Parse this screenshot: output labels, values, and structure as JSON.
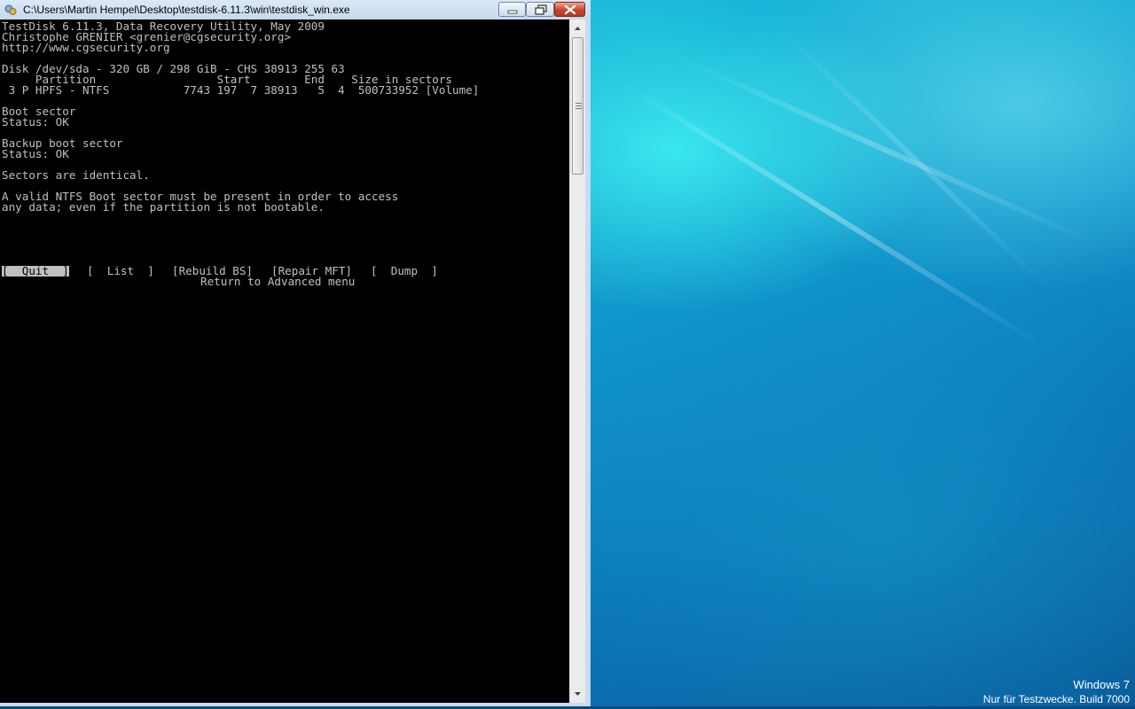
{
  "window": {
    "title": "C:\\Users\\Martin Hempel\\Desktop\\testdisk-6.11.3\\win\\testdisk_win.exe"
  },
  "console": {
    "lines": [
      "TestDisk 6.11.3, Data Recovery Utility, May 2009",
      "Christophe GRENIER <grenier@cgsecurity.org>",
      "http://www.cgsecurity.org",
      "",
      "Disk /dev/sda - 320 GB / 298 GiB - CHS 38913 255 63",
      "     Partition                  Start        End    Size in sectors",
      " 3 P HPFS - NTFS           7743 197  7 38913   5  4  500733952 [Volume]",
      "",
      "Boot sector",
      "Status: OK",
      "",
      "Backup boot sector",
      "Status: OK",
      "",
      "Sectors are identical.",
      "",
      "A valid NTFS Boot sector must be present in order to access",
      "any data; even if the partition is not bootable."
    ],
    "menu": [
      {
        "label": "[  Quit  ]",
        "selected": true
      },
      {
        "label": "[  List  ]",
        "selected": false
      },
      {
        "label": "[Rebuild BS]",
        "selected": false
      },
      {
        "label": "[Repair MFT]",
        "selected": false
      },
      {
        "label": "[  Dump  ]",
        "selected": false
      }
    ],
    "hint": "Return to Advanced menu"
  },
  "desktop": {
    "watermark_line1": "Windows 7",
    "watermark_line2": "Nur für Testzwecke. Build 7000"
  },
  "colors": {
    "console_bg": "#000000",
    "console_fg": "#c0c0c0",
    "selected_bg": "#c0c0c0"
  }
}
